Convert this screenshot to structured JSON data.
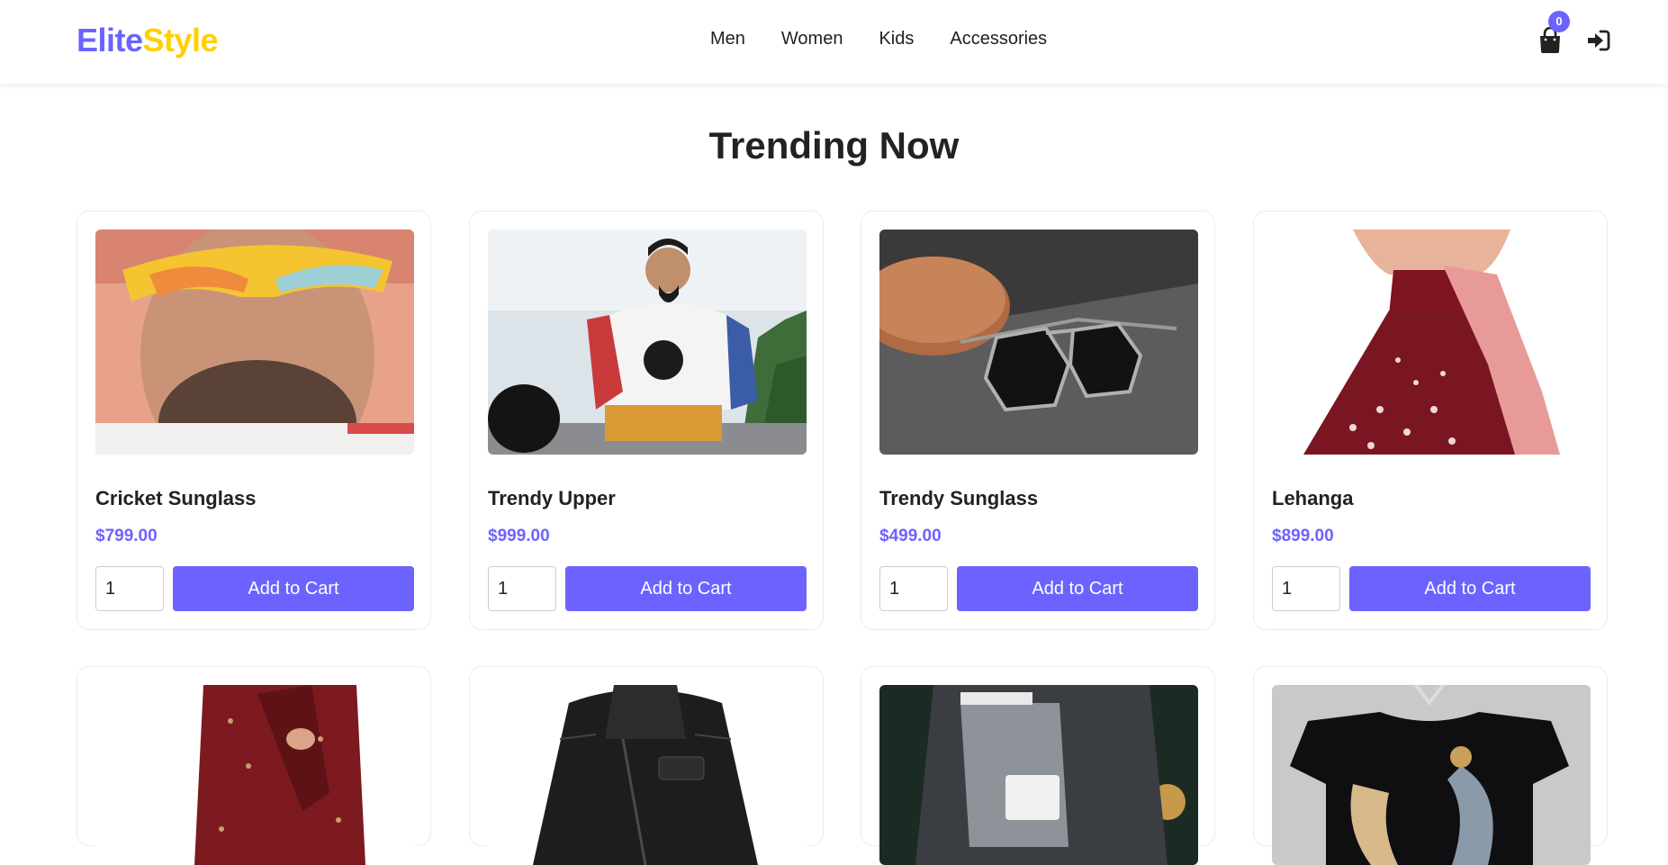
{
  "header": {
    "logo_part1": "Elite",
    "logo_part2": "Style",
    "nav": [
      "Men",
      "Women",
      "Kids",
      "Accessories"
    ],
    "cart_count": "0",
    "cart_icon": "shopping-bag-icon",
    "login_icon": "sign-in-icon"
  },
  "section_title": "Trending Now",
  "products": [
    {
      "name": "Cricket Sunglass",
      "price": "$799.00",
      "qty": "1",
      "button": "Add to Cart"
    },
    {
      "name": "Trendy Upper",
      "price": "$999.00",
      "qty": "1",
      "button": "Add to Cart"
    },
    {
      "name": "Trendy Sunglass",
      "price": "$499.00",
      "qty": "1",
      "button": "Add to Cart"
    },
    {
      "name": "Lehanga",
      "price": "$899.00",
      "qty": "1",
      "button": "Add to Cart"
    },
    {
      "name": "",
      "price": "",
      "qty": "",
      "button": ""
    },
    {
      "name": "",
      "price": "",
      "qty": "",
      "button": ""
    },
    {
      "name": "",
      "price": "",
      "qty": "",
      "button": ""
    },
    {
      "name": "",
      "price": "",
      "qty": "",
      "button": ""
    }
  ],
  "colors": {
    "accent": "#6c63ff",
    "logo_yellow": "#ffd000",
    "text": "#222222"
  }
}
